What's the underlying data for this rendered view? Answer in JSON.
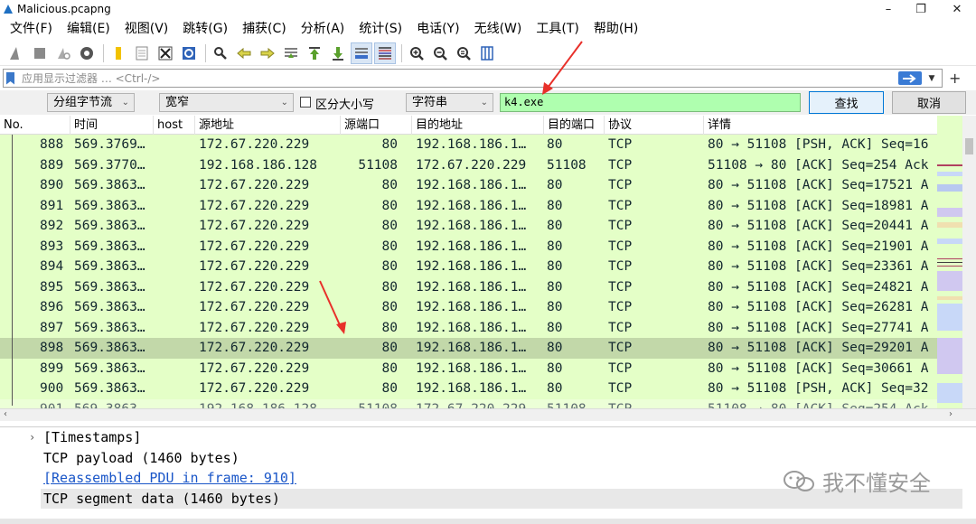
{
  "window": {
    "title": "Malicious.pcapng",
    "minimize": "–",
    "maximize": "❐",
    "close": "✕"
  },
  "menu": [
    "文件(F)",
    "编辑(E)",
    "视图(V)",
    "跳转(G)",
    "捕获(C)",
    "分析(A)",
    "统计(S)",
    "电话(Y)",
    "无线(W)",
    "工具(T)",
    "帮助(H)"
  ],
  "toolbar_icons": [
    "shark-start-icon",
    "stop-icon",
    "restart-icon",
    "capture-options-icon",
    "open-file-icon",
    "file-icon",
    "close-file-icon",
    "reload-icon",
    "find-packet-icon",
    "go-back-icon",
    "go-forward-icon",
    "go-to-packet-icon",
    "first-packet-icon",
    "last-packet-icon",
    "autoscroll-icon",
    "colorize-icon",
    "zoom-in-icon",
    "zoom-out-icon",
    "zoom-normal-icon",
    "resize-columns-icon"
  ],
  "filter": {
    "placeholder": "应用显示过滤器 … <Ctrl-/>",
    "plus": "+"
  },
  "find": {
    "scope": "分组字节流",
    "charset": "宽窄",
    "case_label": "区分大小写",
    "type": "字符串",
    "value": "k4.exe",
    "find_button": "查找",
    "cancel_button": "取消"
  },
  "columns": [
    "No.",
    "时间",
    "host",
    "源地址",
    "源端口",
    "目的地址",
    "目的端口",
    "协议",
    "详情"
  ],
  "packets": [
    {
      "no": "888",
      "time": "569.3769…",
      "host": "",
      "src": "172.67.220.229",
      "sport": "80",
      "dst": "192.168.186.1…",
      "dport": "80",
      "proto": "TCP",
      "info": "80 → 51108 [PSH, ACK] Seq=16"
    },
    {
      "no": "889",
      "time": "569.3770…",
      "host": "",
      "src": "192.168.186.128",
      "sport": "51108",
      "dst": "172.67.220.229",
      "dport": "51108",
      "proto": "TCP",
      "info": "51108 → 80 [ACK] Seq=254 Ack"
    },
    {
      "no": "890",
      "time": "569.3863…",
      "host": "",
      "src": "172.67.220.229",
      "sport": "80",
      "dst": "192.168.186.1…",
      "dport": "80",
      "proto": "TCP",
      "info": "80 → 51108 [ACK] Seq=17521 A"
    },
    {
      "no": "891",
      "time": "569.3863…",
      "host": "",
      "src": "172.67.220.229",
      "sport": "80",
      "dst": "192.168.186.1…",
      "dport": "80",
      "proto": "TCP",
      "info": "80 → 51108 [ACK] Seq=18981 A"
    },
    {
      "no": "892",
      "time": "569.3863…",
      "host": "",
      "src": "172.67.220.229",
      "sport": "80",
      "dst": "192.168.186.1…",
      "dport": "80",
      "proto": "TCP",
      "info": "80 → 51108 [ACK] Seq=20441 A"
    },
    {
      "no": "893",
      "time": "569.3863…",
      "host": "",
      "src": "172.67.220.229",
      "sport": "80",
      "dst": "192.168.186.1…",
      "dport": "80",
      "proto": "TCP",
      "info": "80 → 51108 [ACK] Seq=21901 A"
    },
    {
      "no": "894",
      "time": "569.3863…",
      "host": "",
      "src": "172.67.220.229",
      "sport": "80",
      "dst": "192.168.186.1…",
      "dport": "80",
      "proto": "TCP",
      "info": "80 → 51108 [ACK] Seq=23361 A"
    },
    {
      "no": "895",
      "time": "569.3863…",
      "host": "",
      "src": "172.67.220.229",
      "sport": "80",
      "dst": "192.168.186.1…",
      "dport": "80",
      "proto": "TCP",
      "info": "80 → 51108 [ACK] Seq=24821 A"
    },
    {
      "no": "896",
      "time": "569.3863…",
      "host": "",
      "src": "172.67.220.229",
      "sport": "80",
      "dst": "192.168.186.1…",
      "dport": "80",
      "proto": "TCP",
      "info": "80 → 51108 [ACK] Seq=26281 A"
    },
    {
      "no": "897",
      "time": "569.3863…",
      "host": "",
      "src": "172.67.220.229",
      "sport": "80",
      "dst": "192.168.186.1…",
      "dport": "80",
      "proto": "TCP",
      "info": "80 → 51108 [ACK] Seq=27741 A"
    },
    {
      "no": "898",
      "time": "569.3863…",
      "host": "",
      "src": "172.67.220.229",
      "sport": "80",
      "dst": "192.168.186.1…",
      "dport": "80",
      "proto": "TCP",
      "info": "80 → 51108 [ACK] Seq=29201 A",
      "selected": true
    },
    {
      "no": "899",
      "time": "569.3863…",
      "host": "",
      "src": "172.67.220.229",
      "sport": "80",
      "dst": "192.168.186.1…",
      "dport": "80",
      "proto": "TCP",
      "info": "80 → 51108 [ACK] Seq=30661 A"
    },
    {
      "no": "900",
      "time": "569.3863…",
      "host": "",
      "src": "172.67.220.229",
      "sport": "80",
      "dst": "192.168.186.1…",
      "dport": "80",
      "proto": "TCP",
      "info": "80 → 51108 [PSH, ACK] Seq=32"
    },
    {
      "no": "901",
      "time": "569.3863…",
      "host": "",
      "src": "192.168.186.128",
      "sport": "51108",
      "dst": "172.67.220.229",
      "dport": "51108",
      "proto": "TCP",
      "info": "51108 → 80 [ACK] Seq=254 Ack"
    }
  ],
  "details": {
    "timestamps": "[Timestamps]",
    "payload": "TCP payload (1460 bytes)",
    "reassembled": "[Reassembled PDU in frame: 910]",
    "segment": "TCP segment data (1460 bytes)",
    "expander": "›"
  },
  "watermark": "我不懂安全",
  "colors": {
    "row_bg": "#e4ffc7",
    "row_selected": "#c2d8a9",
    "find_input_bg": "#afffaf",
    "arrow": "#e8302a",
    "link": "#1a56c8"
  }
}
